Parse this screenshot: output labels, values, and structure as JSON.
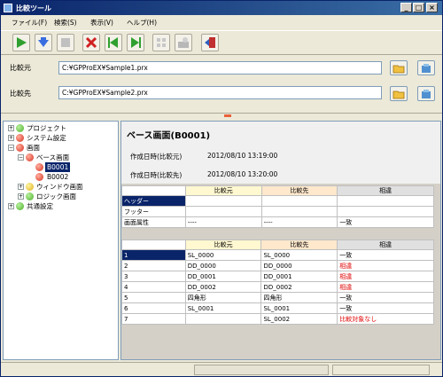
{
  "window": {
    "title": "比較ツール"
  },
  "menu": [
    "ファイル(F)",
    "検索(S)",
    "表示(V)",
    "ヘルプ(H)"
  ],
  "source": {
    "label": "比較元",
    "path": "C:¥GPProEX¥Sample1.prx"
  },
  "target": {
    "label": "比較先",
    "path": "C:¥GPProEX¥Sample2.prx"
  },
  "tree": {
    "items": [
      "プロジェクト",
      "システム設定",
      "画面",
      "ベース画面",
      "B0001",
      "B0002",
      "ウィンドウ画面",
      "ロジック画面",
      "共通設定"
    ]
  },
  "detail": {
    "title": "ベース画面(B0001)",
    "created_src_label": "作成日時(比較元)",
    "created_src": "2012/08/10 13:19:00",
    "created_dst_label": "作成日時(比較先)",
    "created_dst": "2012/08/10 13:20:00",
    "columns": [
      "比較元",
      "比較先",
      "相違"
    ],
    "props": [
      {
        "name": "ヘッダー",
        "src": "",
        "dst": "",
        "diff": ""
      },
      {
        "name": "フッター",
        "src": "",
        "dst": "",
        "diff": ""
      },
      {
        "name": "画面属性",
        "src": "----",
        "dst": "----",
        "diff": "一致"
      }
    ],
    "rows": [
      {
        "n": "1",
        "src": "SL_0000",
        "dst": "SL_0000",
        "diff": "一致"
      },
      {
        "n": "2",
        "src": "DD_0000",
        "dst": "DD_0000",
        "diff": "相違"
      },
      {
        "n": "3",
        "src": "DD_0001",
        "dst": "DD_0001",
        "diff": "相違"
      },
      {
        "n": "4",
        "src": "DD_0002",
        "dst": "DD_0002",
        "diff": "相違"
      },
      {
        "n": "5",
        "src": "四角形",
        "dst": "四角形",
        "diff": "一致"
      },
      {
        "n": "6",
        "src": "SL_0001",
        "dst": "SL_0001",
        "diff": "一致"
      },
      {
        "n": "7",
        "src": "",
        "dst": "SL_0002",
        "diff": "比較対象なし"
      }
    ]
  },
  "colors": {
    "title_bar": "#0a246a",
    "selection": "#0a246a",
    "mismatch": "#e00000",
    "splitter_mark": "#e8603a"
  },
  "icons": [
    "play-icon",
    "download-icon",
    "stop-icon",
    "delete-icon",
    "previous-diff-icon",
    "next-diff-icon",
    "grid-icon",
    "export-icon",
    "exit-icon",
    "folder-icon",
    "project-icon"
  ]
}
